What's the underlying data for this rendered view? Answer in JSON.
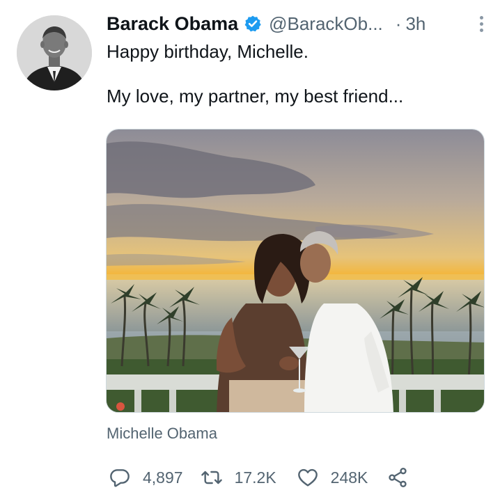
{
  "tweet": {
    "author_name": "Barack Obama",
    "handle": "@BarackOb...",
    "separator": "·",
    "time": "3h",
    "text_line1": "Happy birthday, Michelle.",
    "text_line2": "My love, my partner, my best friend...",
    "tagged_user": "Michelle Obama"
  },
  "actions": {
    "replies": "4,897",
    "retweets": "17.2K",
    "likes": "248K"
  },
  "icons": [
    "verified-badge-icon",
    "more-options-icon",
    "reply-icon",
    "retweet-icon",
    "like-icon",
    "share-icon"
  ],
  "colors": {
    "text_primary": "#0f1419",
    "text_secondary": "#536471",
    "verified_blue": "#1d9bf0"
  }
}
